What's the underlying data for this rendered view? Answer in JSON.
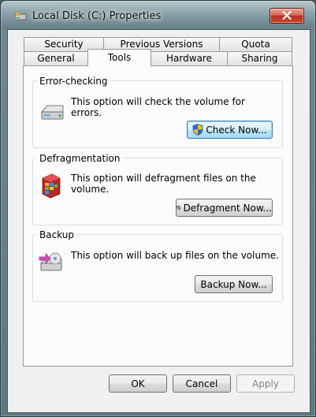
{
  "window": {
    "title": "Local Disk (C:) Properties",
    "icons": {
      "title": "drive-icon",
      "close": "close-icon"
    }
  },
  "tabs": {
    "top_row": [
      "Security",
      "Previous Versions",
      "Quota"
    ],
    "bottom_row": [
      "General",
      "Tools",
      "Hardware",
      "Sharing"
    ],
    "active": "Tools"
  },
  "groups": {
    "error_checking": {
      "label": "Error-checking",
      "description_line1": "This option will check the volume for",
      "description_line2": "errors.",
      "button": "Check Now...",
      "icon": "hard-drive-check-icon"
    },
    "defragmentation": {
      "label": "Defragmentation",
      "description": "This option will defragment files on the volume.",
      "button": "Defragment Now...",
      "icon": "defragment-icon"
    },
    "backup": {
      "label": "Backup",
      "description": "This option will back up files on the volume.",
      "button": "Backup Now...",
      "icon": "backup-icon"
    }
  },
  "footer": {
    "ok": "OK",
    "cancel": "Cancel",
    "apply": "Apply"
  },
  "colors": {
    "accent_button_border": "#3c7fb1",
    "close_button": "#c9452e",
    "shield_blue": "#2b6cc4",
    "shield_yellow": "#f2c230"
  }
}
